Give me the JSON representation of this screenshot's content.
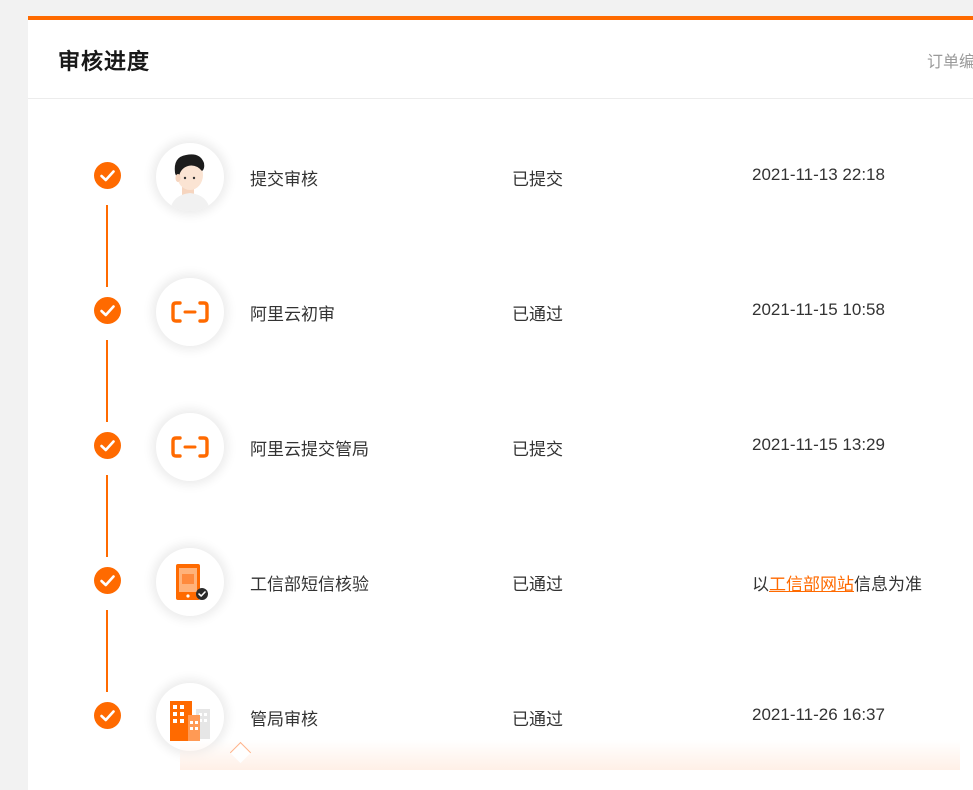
{
  "header": {
    "title": "审核进度",
    "order_label": "订单编号"
  },
  "colors": {
    "accent": "#ff6a00",
    "text": "#333333",
    "muted": "#9a9a9a"
  },
  "steps": [
    {
      "name": "提交审核",
      "status": "已提交",
      "time": "2021-11-13 22:18",
      "icon": "user-avatar-icon"
    },
    {
      "name": "阿里云初审",
      "status": "已通过",
      "time": "2021-11-15 10:58",
      "icon": "aliyun-logo-icon"
    },
    {
      "name": "阿里云提交管局",
      "status": "已提交",
      "time": "2021-11-15 13:29",
      "icon": "aliyun-logo-icon"
    },
    {
      "name": "工信部短信核验",
      "status": "已通过",
      "time_prefix": "以",
      "time_link": "工信部网站",
      "time_suffix": "信息为准",
      "icon": "phone-verify-icon"
    },
    {
      "name": "管局审核",
      "status": "已通过",
      "time": "2021-11-26 16:37",
      "icon": "building-icon"
    }
  ]
}
